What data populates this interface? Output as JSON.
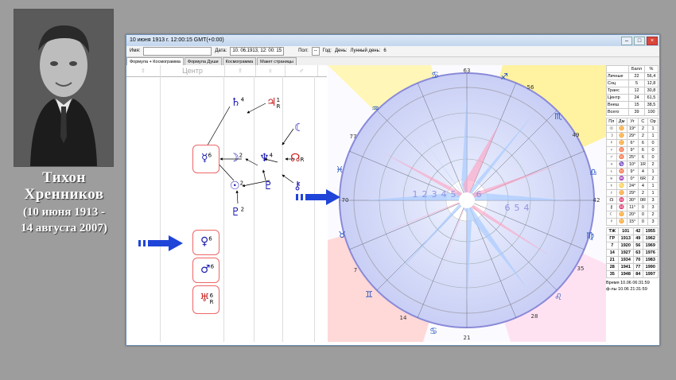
{
  "person": {
    "name_line1": "Тихон",
    "name_line2": "Хренников",
    "dates_line1": "(10 июня 1913 -",
    "dates_line2": "14 августа 2007)"
  },
  "window": {
    "title": "10 июня 1913 г. 12:00:15 GMT(+0:00)",
    "name_label": "Имя:",
    "date_label": "Дата:",
    "date_value": "10. 06.1913",
    "time_value": "12: 00: 15",
    "sex_label": "Пол:",
    "sex_value": "--",
    "year_label": "Год:",
    "day_label": "День:",
    "lunar_day_label": "Лунный день:",
    "lunar_day_value": "6"
  },
  "tabs": [
    "Формула + Космограмма",
    "Формула Души",
    "Космограмма",
    "Макет страницы"
  ],
  "formula": {
    "headers": [
      "☿",
      "Центр",
      "☿",
      "♀",
      "♂"
    ],
    "nodes": [
      {
        "glyph": "♄",
        "num": "4",
        "color": "#1a1ab0"
      },
      {
        "glyph": "♃",
        "num": "1",
        "sub": "R",
        "color": "#c82020"
      },
      {
        "glyph": "☿",
        "num": "6",
        "color": "#1a1ab0"
      },
      {
        "glyph": "☽",
        "num": "2",
        "color": "#1a1ab0"
      },
      {
        "glyph": "♆",
        "num": "4",
        "color": "#1a1ab0"
      },
      {
        "glyph": "☊",
        "sub": "R",
        "color": "#c82020"
      },
      {
        "glyph": "☾",
        "color": "#1a1ab0"
      },
      {
        "glyph": "☉",
        "num": "2",
        "color": "#1a1ab0"
      },
      {
        "glyph": "♇",
        "color": "#1a1ab0"
      },
      {
        "glyph": "⚷",
        "color": "#1a1ab0"
      },
      {
        "glyph": "♇",
        "num": "2",
        "color": "#1a1ab0"
      },
      {
        "glyph": "♀",
        "num": "6",
        "color": "#1a1ab0"
      },
      {
        "glyph": "♂",
        "num": "6",
        "color": "#1a1ab0"
      },
      {
        "glyph": "♅",
        "num": "6",
        "sub": "R",
        "color": "#c82020"
      }
    ]
  },
  "chart": {
    "house_labels": [
      "63",
      "56",
      "49",
      "42",
      "35",
      "28",
      "21",
      "14",
      "7",
      "70",
      "77"
    ],
    "inner_numbers": [
      "1",
      "2",
      "3",
      "4",
      "5",
      "6",
      "6",
      "5",
      "4"
    ]
  },
  "stats": {
    "header": [
      "",
      "Балл",
      "%"
    ],
    "rows": [
      [
        "Личные",
        "22",
        "56,4"
      ],
      [
        "Соц",
        "5",
        "12,8"
      ],
      [
        "Транс",
        "12",
        "30,8"
      ],
      [
        "Центр",
        "24",
        "61,5"
      ],
      [
        "Внеш",
        "15",
        "38,5"
      ],
      [
        "Всего",
        "39",
        "100"
      ]
    ],
    "planet_header": [
      "Пл",
      "Дм",
      "Уг",
      "С",
      "Ор"
    ],
    "planets": [
      [
        "☉",
        "♊",
        "19°",
        "2",
        "1"
      ],
      [
        "☽",
        "♊",
        "29°",
        "2",
        "1"
      ],
      [
        "☿",
        "♊",
        "6°",
        "6",
        "0"
      ],
      [
        "♀",
        "♉",
        "9°",
        "6",
        "0"
      ],
      [
        "♂",
        "♉",
        "25°",
        "6",
        "0"
      ],
      [
        "♃",
        "♑",
        "10°",
        "1R",
        "2"
      ],
      [
        "♄",
        "♉",
        "9°",
        "4",
        "1"
      ],
      [
        "♅",
        "♒",
        "0°",
        "6R",
        "2"
      ],
      [
        "♆",
        "♋",
        "24°",
        "4",
        "1"
      ],
      [
        "♇",
        "♊",
        "29°",
        "2",
        "1"
      ],
      [
        "☊",
        "♓",
        "30°",
        "0R",
        "3"
      ],
      [
        "⚷",
        "♓",
        "11°",
        "0",
        "3"
      ],
      [
        "☾",
        "♊",
        "20°",
        "0",
        "2"
      ],
      [
        "☿",
        "♊",
        "15°",
        "0",
        "3"
      ]
    ],
    "years": [
      [
        "ТЖ",
        "101",
        "42",
        "1955"
      ],
      [
        "ГР",
        "1913",
        "49",
        "1962"
      ],
      [
        "7",
        "1920",
        "56",
        "1969"
      ],
      [
        "14",
        "1927",
        "63",
        "1976"
      ],
      [
        "21",
        "1934",
        "70",
        "1983"
      ],
      [
        "28",
        "1941",
        "77",
        "1990"
      ],
      [
        "35",
        "1948",
        "84",
        "1997"
      ]
    ],
    "time_label": "Время",
    "time_value": "10.06 06:31:59",
    "ffly_label": "ф-лы",
    "ffly_value": "10.06 21:31:59"
  }
}
